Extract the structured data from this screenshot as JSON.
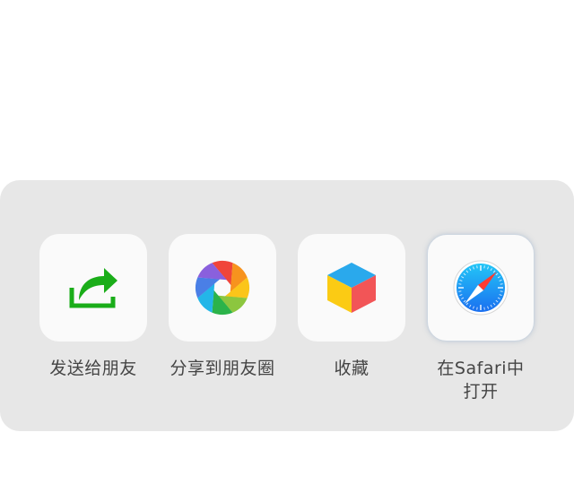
{
  "share_sheet": {
    "actions": [
      {
        "label": "发送给朋友",
        "icon": "share-arrow-icon",
        "color": "#1aad19"
      },
      {
        "label": "分享到朋友圈",
        "icon": "moments-aperture-icon",
        "color": "multicolor"
      },
      {
        "label": "收藏",
        "icon": "favorites-cube-icon",
        "color": "multicolor"
      },
      {
        "label_line1": "在Safari中",
        "label_line2": "打开",
        "icon": "safari-compass-icon",
        "color": "#1e88f0"
      }
    ]
  }
}
